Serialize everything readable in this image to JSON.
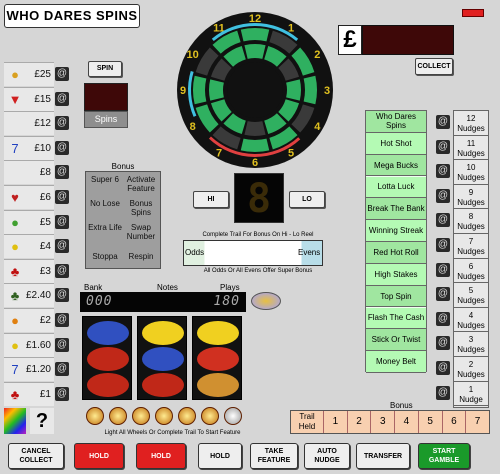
{
  "title": "WHO DARES SPINS",
  "credit": {
    "currency_symbol": "£"
  },
  "buttons": {
    "spin": "SPIN",
    "collect": "COLLECT",
    "hi": "HI",
    "lo": "LO"
  },
  "spins_label": "Spins",
  "ladder": [
    {
      "icon": "rainbow-ball-icon",
      "value": "£25"
    },
    {
      "icon": "red-tshirt-icon",
      "value": "£15"
    },
    {
      "icon": "blank",
      "value": "£12"
    },
    {
      "icon": "blue-seven-icon",
      "value": "£10"
    },
    {
      "icon": "blank",
      "value": "£8"
    },
    {
      "icon": "strawberry-icon",
      "value": "£6"
    },
    {
      "icon": "melon-icon",
      "value": "£5"
    },
    {
      "icon": "lemon-icon",
      "value": "£4"
    },
    {
      "icon": "cherry-icon",
      "value": "£3"
    },
    {
      "icon": "grape-icon",
      "value": "£2.40"
    },
    {
      "icon": "orange-icon",
      "value": "£2"
    },
    {
      "icon": "lemon-icon",
      "value": "£1.60"
    },
    {
      "icon": "blue-seven-icon",
      "value": "£1.20"
    },
    {
      "icon": "cherry-icon",
      "value": "£1"
    }
  ],
  "question_mark": "?",
  "bonus": {
    "title": "Bonus",
    "cells": [
      [
        "Super 6",
        "Activate Feature"
      ],
      [
        "No Lose",
        "Bonus Spins"
      ],
      [
        "Extra Life",
        "Swap Number"
      ],
      [
        "Stoppa",
        "Respin"
      ]
    ]
  },
  "hilo": {
    "value": "8",
    "trail_caption": "Complete Trail For Bonus On Hi - Lo Reel",
    "odds": "Odds",
    "evens": "Evens",
    "super_caption": "All Odds Or All Evens Offer Super Bonus"
  },
  "meters": {
    "bank_label": "Bank",
    "notes_label": "Notes",
    "plays_label": "Plays",
    "bank": "000",
    "plays": "180"
  },
  "coins_caption": "Light All Wheels Or Complete Trail To Start Feature",
  "wheel": {
    "numbers": [
      "12",
      "1",
      "2",
      "3",
      "4",
      "5",
      "6",
      "7",
      "8",
      "9",
      "10",
      "11"
    ]
  },
  "features": [
    "Who Dares Spins",
    "Hot Shot",
    "Mega Bucks",
    "Lotta Luck",
    "Break The Bank",
    "Winning Streak",
    "Red Hot Roll",
    "High Stakes",
    "Top Spin",
    "Flash The Cash",
    "Stick Or Twist",
    "Money Belt"
  ],
  "nudges": [
    {
      "n": "12",
      "label": "Nudges"
    },
    {
      "n": "11",
      "label": "Nudges"
    },
    {
      "n": "10",
      "label": "Nudges"
    },
    {
      "n": "9",
      "label": "Nudges"
    },
    {
      "n": "8",
      "label": "Nudges"
    },
    {
      "n": "7",
      "label": "Nudges"
    },
    {
      "n": "6",
      "label": "Nudges"
    },
    {
      "n": "5",
      "label": "Nudges"
    },
    {
      "n": "4",
      "label": "Nudges"
    },
    {
      "n": "3",
      "label": "Nudges"
    },
    {
      "n": "2",
      "label": "Nudges"
    },
    {
      "n": "1",
      "label": "Nudge"
    }
  ],
  "trail": {
    "bonus_label": "Bonus",
    "held_label": "Trail Held",
    "steps": [
      "1",
      "2",
      "3",
      "4",
      "5",
      "6",
      "7"
    ]
  },
  "bottom_buttons": [
    {
      "label": "CANCEL COLLECT",
      "color": "#eeeeee"
    },
    {
      "label": "HOLD",
      "color": "#e02020"
    },
    {
      "label": "HOLD",
      "color": "#e02020"
    },
    {
      "label": "HOLD",
      "color": "#eeeeee"
    },
    {
      "label": "TAKE FEATURE",
      "color": "#eeeeee"
    },
    {
      "label": "AUTO NUDGE",
      "color": "#eeeeee"
    },
    {
      "label": "TRANSFER",
      "color": "#eeeeee"
    },
    {
      "label": "START GAMBLE",
      "color": "#1a9a2a"
    }
  ]
}
